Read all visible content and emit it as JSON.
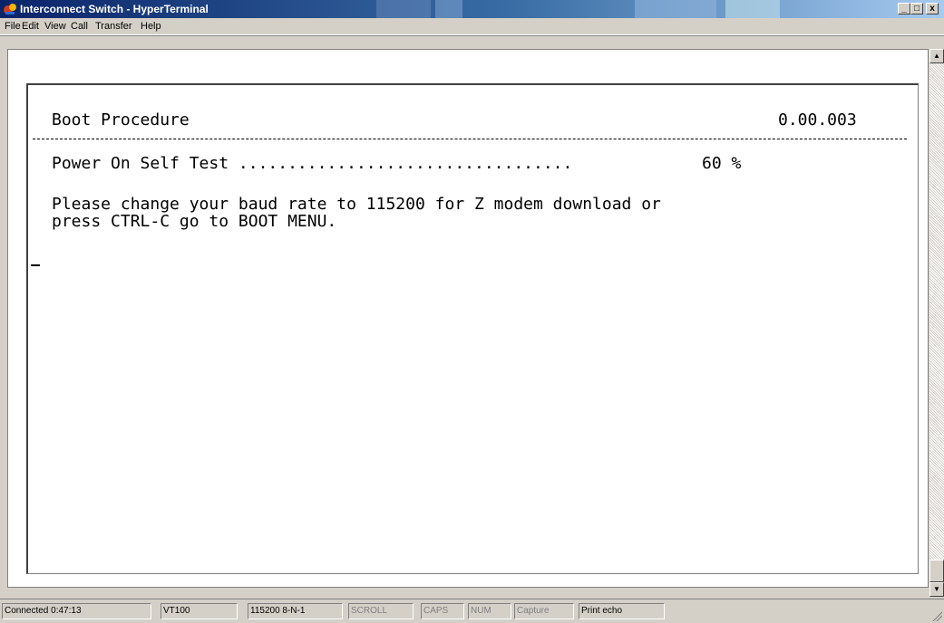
{
  "window": {
    "title": "Interconnect Switch - HyperTerminal",
    "minimize_label": "_",
    "maximize_label": "□",
    "close_label": "x"
  },
  "menu": {
    "items": [
      "File",
      "Edit",
      "View",
      "Call",
      "Transfer",
      "Help"
    ]
  },
  "terminal": {
    "header_title": "Boot Procedure",
    "version": "0.00.003",
    "post_line": "Power On Self Test ..................................",
    "post_progress": "60 %",
    "message_line1": "Please change your baud rate to 115200 for Z modem download or",
    "message_line2": "press CTRL-C go to BOOT MENU."
  },
  "status_bar": {
    "connected": "Connected 0:47:13",
    "emulation": "VT100",
    "port_settings": "115200 8-N-1",
    "scroll": "SCROLL",
    "caps": "CAPS",
    "num": "NUM",
    "capture": "Capture",
    "print_echo": "Print echo"
  },
  "colors": {
    "title_gradient_start": "#0a246a",
    "title_gradient_end": "#a6caf0",
    "face": "#d4d0c8",
    "terminal_bg": "#ffffff"
  }
}
